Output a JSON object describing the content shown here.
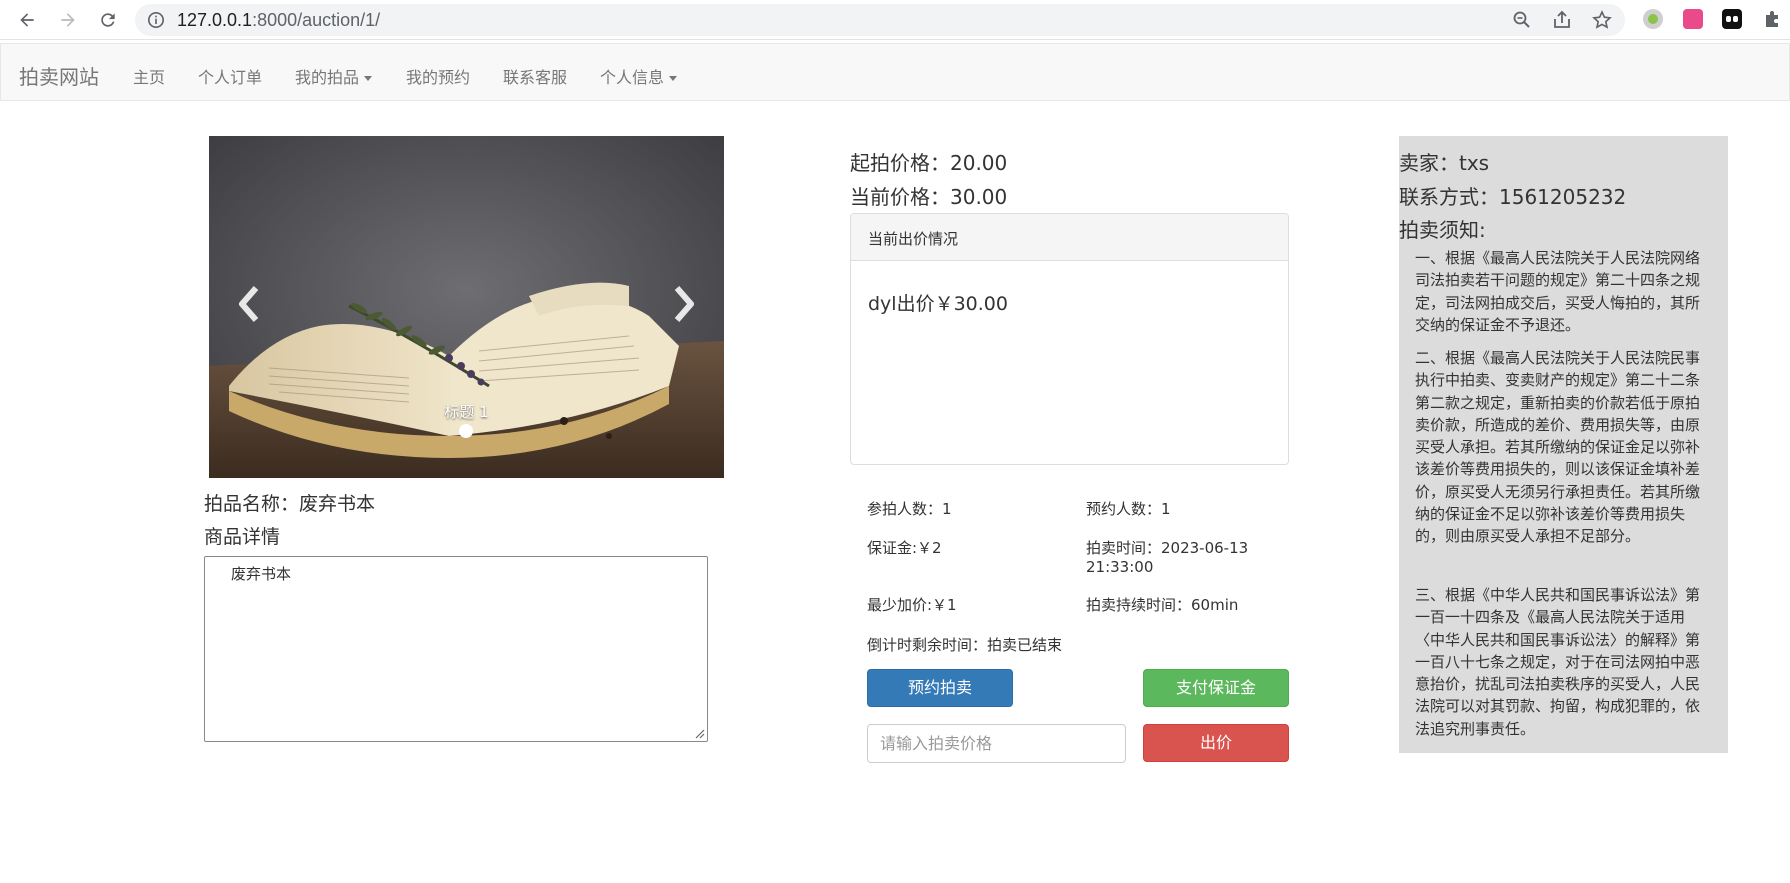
{
  "browser": {
    "url_host": "127.0.0.1",
    "url_rest": ":8000/auction/1/"
  },
  "navbar": {
    "brand": "拍卖网站",
    "items": [
      {
        "label": "主页",
        "dropdown": false
      },
      {
        "label": "个人订单",
        "dropdown": false
      },
      {
        "label": "我的拍品",
        "dropdown": true
      },
      {
        "label": "我的预约",
        "dropdown": false
      },
      {
        "label": "联系客服",
        "dropdown": false
      },
      {
        "label": "个人信息",
        "dropdown": true
      }
    ]
  },
  "carousel": {
    "caption": "标题 1"
  },
  "item": {
    "name_line": "拍品名称：废弃书本",
    "detail_title": "商品详情",
    "detail_text": "废弃书本"
  },
  "pricing": {
    "start_price": "起拍价格：20.00",
    "current_price": "当前价格：30.00"
  },
  "bids_panel": {
    "heading": "当前出价情况",
    "latest_bid": "dyl出价￥30.00"
  },
  "stats": {
    "bidders": "参拍人数：1",
    "reservations": "预约人数：1",
    "deposit": "保证金:￥2",
    "auction_time_label": "拍卖时间：2023-06-13",
    "auction_time_clock": "21:33:00",
    "min_increment": "最少加价:￥1",
    "duration": "拍卖持续时间：60min",
    "countdown": "倒计时剩余时间：拍卖已结束"
  },
  "actions": {
    "reserve_label": "预约拍卖",
    "pay_deposit_label": "支付保证金",
    "bid_placeholder": "请输入拍卖价格",
    "bid_label": "出价"
  },
  "seller": {
    "seller_line": "卖家：txs",
    "contact_line": "联系方式：1561205232",
    "rules_title": "拍卖须知:",
    "rules": [
      "一、根据《最高人民法院关于人民法院网络司法拍卖若干问题的规定》第二十四条之规定，司法网拍成交后，买受人悔拍的，其所交纳的保证金不予退还。",
      "二、根据《最高人民法院关于人民法院民事执行中拍卖、变卖财产的规定》第二十二条第二款之规定，重新拍卖的价款若低于原拍卖价款，所造成的差价、费用损失等，由原买受人承担。若其所缴纳的保证金足以弥补该差价等费用损失的，则以该保证金填补差价，原买受人无须另行承担责任。若其所缴纳的保证金不足以弥补该差价等费用损失的，则由原买受人承担不足部分。",
      "三、根据《中华人民共和国民事诉讼法》第一百一十四条及《最高人民法院关于适用〈中华人民共和国民事诉讼法〉的解释》第一百八十七条之规定，对于在司法网拍中恶意抬价，扰乱司法拍卖秩序的买受人，人民法院可以对其罚款、拘留，构成犯罪的，依法追究刑事责任。"
    ]
  }
}
